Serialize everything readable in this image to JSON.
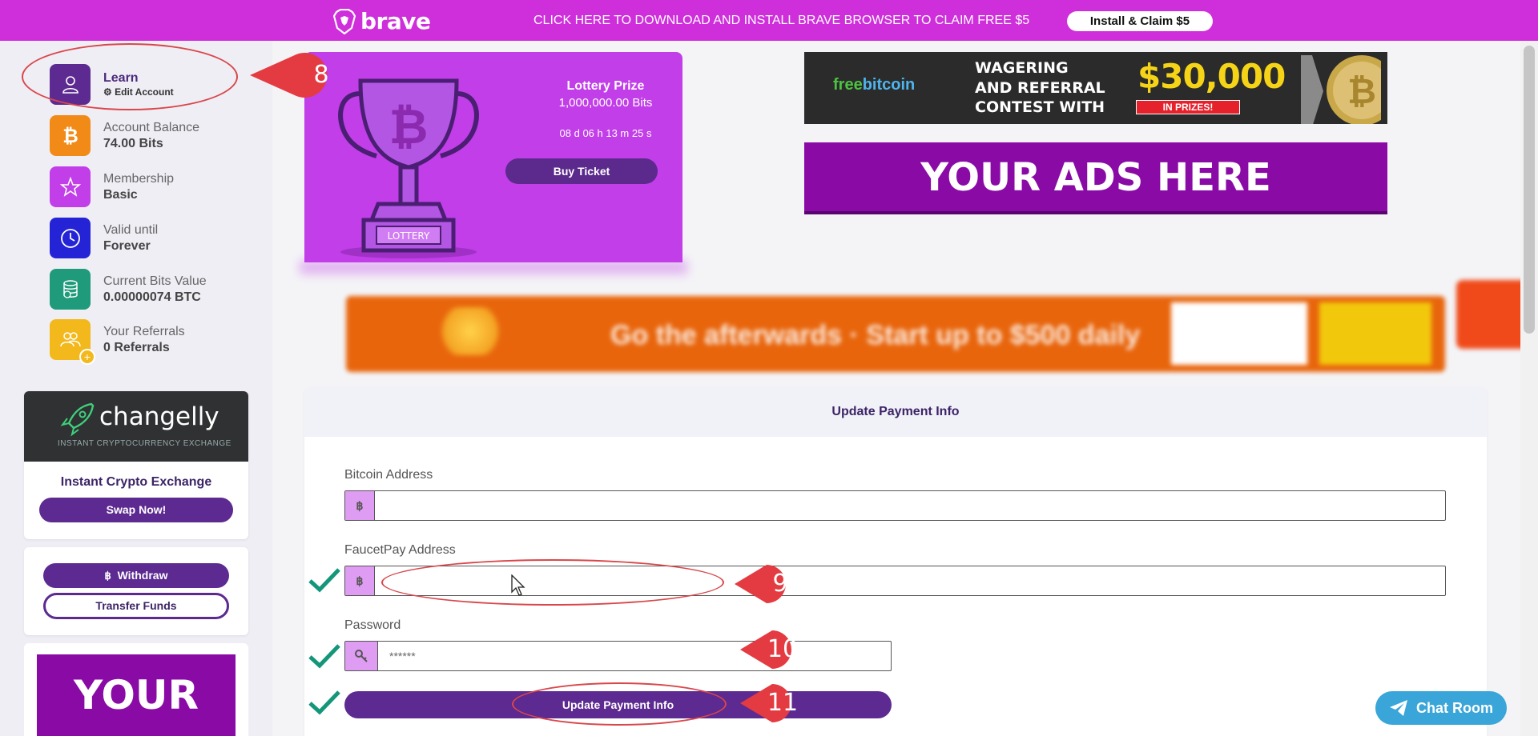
{
  "topbar": {
    "brand": "brave",
    "promo": "CLICK HERE TO DOWNLOAD AND INSTALL BRAVE BROWSER TO CLAIM FREE $5",
    "install_label": "Install & Claim $5",
    "bg_color": "#cf2edb"
  },
  "sidebar": {
    "learn": {
      "label": "Learn",
      "edit": "Edit Account"
    },
    "items": [
      {
        "label": "Account Balance",
        "value": "74.00 Bits",
        "icon": "bitcoin-icon",
        "color": "#f28a18"
      },
      {
        "label": "Membership",
        "value": "Basic",
        "icon": "star-icon",
        "color": "#c13ee8"
      },
      {
        "label": "Valid until",
        "value": "Forever",
        "icon": "clock-icon",
        "color": "#2424d6"
      },
      {
        "label": "Current Bits Value",
        "value": "0.00000074 BTC",
        "icon": "coins-icon",
        "color": "#1f9a7a"
      },
      {
        "label": "Your Referrals",
        "value": "0 Referrals",
        "icon": "users-icon",
        "color": "#f2b81c"
      }
    ],
    "changelly": {
      "brand": "changelly",
      "tagline": "INSTANT CRYPTOCURRENCY EXCHANGE",
      "title": "Instant Crypto Exchange",
      "button": "Swap Now!"
    },
    "withdraw_label": "Withdraw",
    "transfer_label": "Transfer Funds",
    "ad_text": "YOUR"
  },
  "lottery": {
    "title": "Lottery Prize",
    "prize": "1,000,000.00 Bits",
    "timer": "08 d 06 h 13 m 25 s",
    "button": "Buy Ticket",
    "trophy_label": "LOTTERY"
  },
  "ads": {
    "fb_logo_a": "free",
    "fb_logo_b": "bitcoin",
    "fb_contest": [
      "WAGERING",
      "AND REFERRAL",
      "CONTEST WITH"
    ],
    "fb_amount": "$30,000",
    "fb_prizes": "IN PRIZES!",
    "big_ad": "YOUR ADS HERE",
    "orange_text": "Go the afterwards · Start up to $500 daily"
  },
  "payment": {
    "header": "Update Payment Info",
    "bitcoin_label": "Bitcoin Address",
    "bitcoin_value": "",
    "faucetpay_label": "FaucetPay Address",
    "faucetpay_value": "",
    "password_label": "Password",
    "password_value": "******",
    "addon_symbol": "฿",
    "submit": "Update Payment Info"
  },
  "annotations": [
    "8",
    "9",
    "10",
    "11"
  ],
  "chat": {
    "label": "Chat Room"
  }
}
